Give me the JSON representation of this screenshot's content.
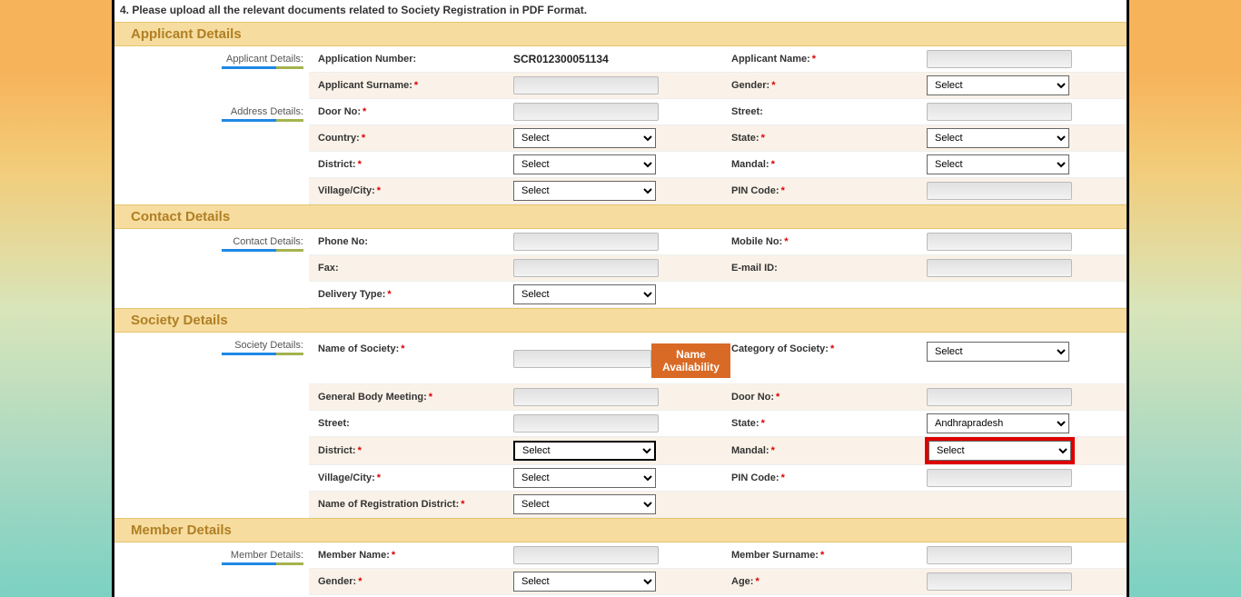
{
  "instruction": "4. Please upload all the relevant documents related to Society Registration in PDF Format.",
  "sections": {
    "applicant": "Applicant Details",
    "contact": "Contact Details",
    "society": "Society Details",
    "member": "Member Details"
  },
  "aside": {
    "applicant": "Applicant Details:",
    "address": "Address Details:",
    "contact": "Contact Details:",
    "society": "Society Details:",
    "member": "Member Details:"
  },
  "labels": {
    "application_number": "Application Number:",
    "applicant_name": "Applicant Name:",
    "applicant_surname": "Applicant Surname:",
    "gender": "Gender:",
    "door_no": "Door No:",
    "street": "Street:",
    "country": "Country:",
    "state": "State:",
    "district": "District:",
    "mandal": "Mandal:",
    "village_city": "Village/City:",
    "pin_code": "PIN Code:",
    "phone_no": "Phone No:",
    "mobile_no": "Mobile No:",
    "fax": "Fax:",
    "email_id": "E-mail ID:",
    "delivery_type": "Delivery Type:",
    "name_of_society": "Name of  Society:",
    "name_availability": "Name Availability",
    "category_of_society": "Category of Society:",
    "general_body_meeting": "General Body Meeting:",
    "name_of_reg_district": "Name of Registration District:",
    "member_name": "Member Name:",
    "member_surname": "Member Surname:",
    "age": "Age:"
  },
  "values": {
    "application_number": "SCR012300051134",
    "select_placeholder": "Select",
    "state_ap": "Andhrapradesh"
  }
}
